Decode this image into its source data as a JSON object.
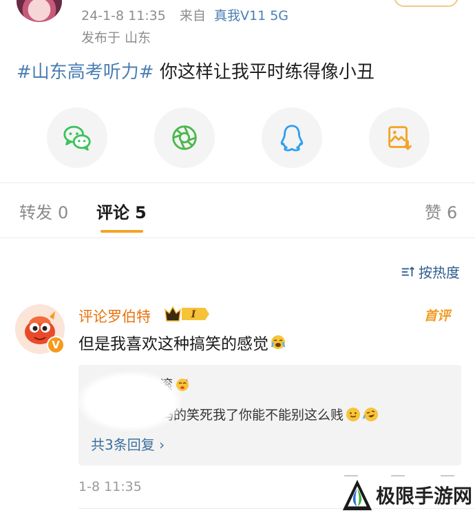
{
  "post": {
    "timestamp": "24-1-8 11:35",
    "source_prefix": "来自",
    "device": "真我V11 5G",
    "location": "发布于 山东",
    "topic": "#山东高考听力#",
    "body": " 你这样让我平时练得像小丑"
  },
  "share": [
    {
      "icon": "wechat-icon",
      "color": "#3bc35c"
    },
    {
      "icon": "moments-icon",
      "color": "#4ab84a"
    },
    {
      "icon": "qq-icon",
      "color": "#2f9ff0"
    },
    {
      "icon": "save-image-icon",
      "color": "#f4a325"
    }
  ],
  "tabs": {
    "repost": {
      "label": "转发",
      "count": "0"
    },
    "comment": {
      "label": "评论",
      "count": "5"
    },
    "like": {
      "label": "赞",
      "count": "6"
    }
  },
  "sort": {
    "label": "按热度",
    "icon": "sort-icon"
  },
  "comment": {
    "author": "评论罗伯特",
    "vip_level": "I",
    "first_badge": "首评",
    "text": "但是我喜欢这种搞笑的感觉",
    "reply_line1": "滚",
    "reply_line2": "尼玛的笑死我了你能不能别这么贱",
    "more_replies": "共3条回复 ›",
    "time": "1-8 11:35"
  },
  "watermark": {
    "text": "极限手游网"
  },
  "colors": {
    "accent": "#f4a325",
    "link": "#4a7eb3",
    "author": "#e8730c"
  }
}
